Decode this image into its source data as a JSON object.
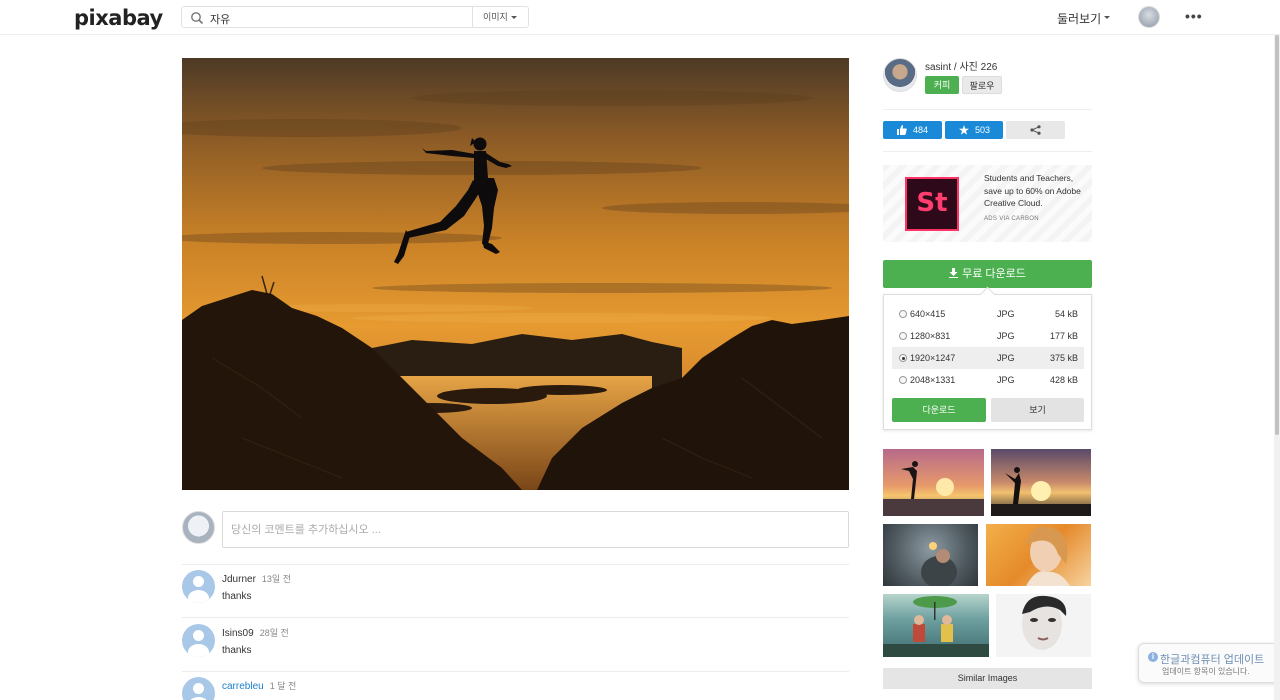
{
  "header": {
    "logo": "pixabay",
    "search_value": "자유",
    "search_type": "이미지",
    "explore_label": "둘러보기",
    "more_label": "•••"
  },
  "comment_box": {
    "placeholder": "당신의 코멘트를 추가하십시오 ..."
  },
  "comments": [
    {
      "user": "Jdurner",
      "time": "13일 전",
      "text": "thanks"
    },
    {
      "user": "Isins09",
      "time": "28일 전",
      "text": "thanks"
    },
    {
      "user": "carrebleu",
      "time": "1 달 전",
      "text": ""
    }
  ],
  "author": {
    "line": "sasint / 사진 226",
    "coffee_label": "커피",
    "follow_label": "팔로우"
  },
  "stats": {
    "likes": "484",
    "favorites": "503"
  },
  "ad": {
    "logo_text": "St",
    "text": "Students and Teachers, save up to 60% on Adobe Creative Cloud.",
    "via": "ADS VIA CARBON"
  },
  "download": {
    "button_label": "무료 다운로드",
    "options": [
      {
        "res": "640×415",
        "format": "JPG",
        "size": "54 kB",
        "selected": false
      },
      {
        "res": "1280×831",
        "format": "JPG",
        "size": "177 kB",
        "selected": false
      },
      {
        "res": "1920×1247",
        "format": "JPG",
        "size": "375 kB",
        "selected": true
      },
      {
        "res": "2048×1331",
        "format": "JPG",
        "size": "428 kB",
        "selected": false
      }
    ],
    "download_label": "다운로드",
    "view_label": "보기"
  },
  "similar_label": "Similar Images",
  "notification": {
    "title": "한글과컴퓨터 업데이트",
    "subtitle": "업데이트 항목이 있습니다."
  },
  "colors": {
    "green": "#4caf50",
    "blue": "#1a8ad8",
    "link": "#1b7fcc"
  }
}
